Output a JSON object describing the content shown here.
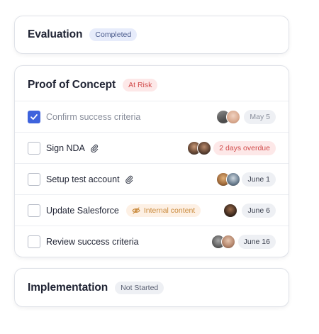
{
  "stages": {
    "evaluation": {
      "title": "Evaluation",
      "status": "Completed"
    },
    "poc": {
      "title": "Proof of Concept",
      "status": "At Risk",
      "tasks": [
        {
          "label": "Confirm success criteria",
          "done": true,
          "attachment": false,
          "due": "May 5"
        },
        {
          "label": "Sign NDA",
          "done": false,
          "attachment": true,
          "due": "2 days overdue"
        },
        {
          "label": "Setup test account",
          "done": false,
          "attachment": true,
          "due": "June 1"
        },
        {
          "label": "Update Salesforce",
          "done": false,
          "attachment": false,
          "tag": "Internal content",
          "due": "June 6"
        },
        {
          "label": "Review success criteria",
          "done": false,
          "attachment": false,
          "due": "June 16"
        }
      ]
    },
    "implementation": {
      "title": "Implementation",
      "status": "Not Started"
    }
  },
  "colors": {
    "accent": "#3e63dd",
    "completed_bg": "#e7ecfb",
    "risk_text": "#d14b4b",
    "risk_bg": "#fde8e8",
    "internal_bg": "#fdf0e4"
  },
  "icons": [
    "check-icon",
    "paperclip-icon",
    "eye-off-icon"
  ]
}
